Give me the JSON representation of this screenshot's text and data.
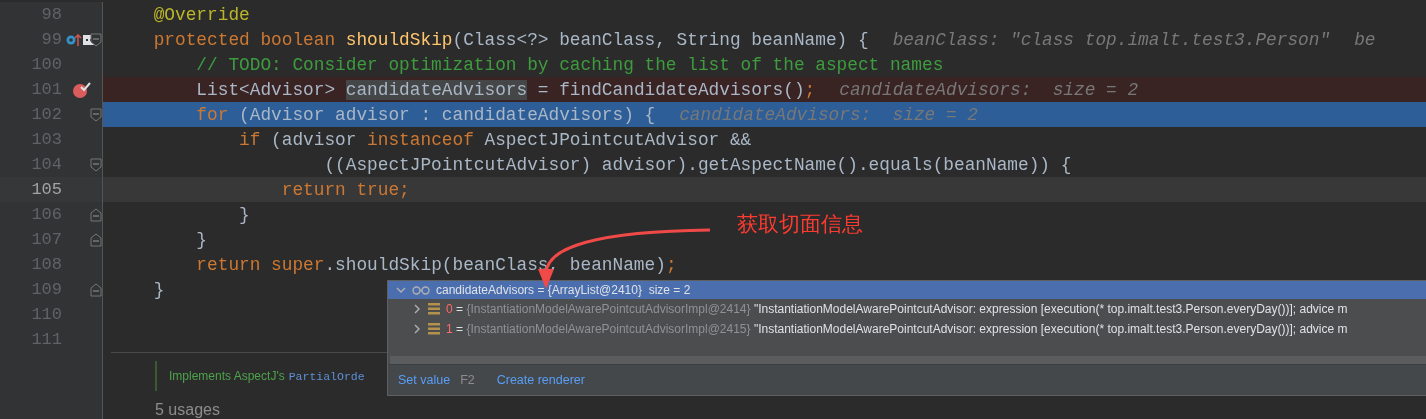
{
  "editor": {
    "lines": [
      {
        "number": "98",
        "breakpoint": false,
        "execution_point": false,
        "caret_line": false,
        "override_marker": false,
        "fold_start": false,
        "fold_end": false,
        "tokens": [
          {
            "text": "    @Override",
            "kind": "annotation"
          }
        ]
      },
      {
        "number": "99",
        "breakpoint": false,
        "execution_point": false,
        "caret_line": false,
        "override_marker": true,
        "fold_start": true,
        "fold_end": false,
        "tokens": [
          {
            "text": "    protected boolean ",
            "kind": "keyword"
          },
          {
            "text": "shouldSkip",
            "kind": "method"
          },
          {
            "text": "(Class<?> beanClass, String beanName) {",
            "kind": "plain"
          }
        ],
        "hints": [
          "beanClass: \"class top.imalt.test3.Person\"",
          "be"
        ]
      },
      {
        "number": "100",
        "breakpoint": false,
        "execution_point": false,
        "caret_line": false,
        "override_marker": false,
        "fold_start": false,
        "fold_end": false,
        "tokens": [
          {
            "text": "        // TODO: Consider optimization by caching the list of the aspect names",
            "kind": "comment"
          }
        ]
      },
      {
        "number": "101",
        "breakpoint": true,
        "execution_point": false,
        "caret_line": false,
        "override_marker": false,
        "fold_start": false,
        "fold_end": false,
        "tokens": [
          {
            "text": "        List<Advisor> ",
            "kind": "plain"
          },
          {
            "text": "candidateAdvisors",
            "kind": "usage"
          },
          {
            "text": " = findCandidateAdvisors()",
            "kind": "plain"
          },
          {
            "text": ";",
            "kind": "keyword"
          }
        ],
        "hints": [
          "candidateAdvisors:  size = 2"
        ]
      },
      {
        "number": "102",
        "breakpoint": false,
        "execution_point": true,
        "caret_line": false,
        "override_marker": false,
        "fold_start": true,
        "fold_end": false,
        "tokens": [
          {
            "text": "        for ",
            "kind": "keyword"
          },
          {
            "text": "(Advisor advisor : candidateAdvisors) {",
            "kind": "plain"
          }
        ],
        "hints": [
          "candidateAdvisors:  size = 2"
        ]
      },
      {
        "number": "103",
        "breakpoint": false,
        "execution_point": false,
        "caret_line": false,
        "override_marker": false,
        "fold_start": false,
        "fold_end": false,
        "tokens": [
          {
            "text": "            if ",
            "kind": "keyword"
          },
          {
            "text": "(advisor ",
            "kind": "plain"
          },
          {
            "text": "instanceof ",
            "kind": "keyword"
          },
          {
            "text": "AspectJPointcutAdvisor &&",
            "kind": "plain"
          }
        ]
      },
      {
        "number": "104",
        "breakpoint": false,
        "execution_point": false,
        "caret_line": false,
        "override_marker": false,
        "fold_start": true,
        "fold_end": false,
        "tokens": [
          {
            "text": "                    ((AspectJPointcutAdvisor) advisor).getAspectName().equals(beanName)) {",
            "kind": "plain"
          }
        ]
      },
      {
        "number": "105",
        "breakpoint": false,
        "execution_point": false,
        "caret_line": true,
        "override_marker": false,
        "fold_start": false,
        "fold_end": false,
        "tokens": [
          {
            "text": "                return true;",
            "kind": "keyword"
          }
        ]
      },
      {
        "number": "106",
        "breakpoint": false,
        "execution_point": false,
        "caret_line": false,
        "override_marker": false,
        "fold_start": false,
        "fold_end": true,
        "tokens": [
          {
            "text": "            }",
            "kind": "plain"
          }
        ]
      },
      {
        "number": "107",
        "breakpoint": false,
        "execution_point": false,
        "caret_line": false,
        "override_marker": false,
        "fold_start": false,
        "fold_end": true,
        "tokens": [
          {
            "text": "        }",
            "kind": "plain"
          }
        ]
      },
      {
        "number": "108",
        "breakpoint": false,
        "execution_point": false,
        "caret_line": false,
        "override_marker": false,
        "fold_start": false,
        "fold_end": false,
        "tokens": [
          {
            "text": "        return super",
            "kind": "keyword"
          },
          {
            "text": ".shouldSkip(beanClass, beanName)",
            "kind": "plain"
          },
          {
            "text": ";",
            "kind": "keyword"
          }
        ]
      },
      {
        "number": "109",
        "breakpoint": false,
        "execution_point": false,
        "caret_line": false,
        "override_marker": false,
        "fold_start": false,
        "fold_end": true,
        "tokens": [
          {
            "text": "    }",
            "kind": "plain"
          }
        ]
      },
      {
        "number": "110",
        "breakpoint": false,
        "execution_point": false,
        "caret_line": false,
        "override_marker": false,
        "fold_start": false,
        "fold_end": false
      },
      {
        "number": "111",
        "breakpoint": false,
        "execution_point": false,
        "caret_line": false,
        "override_marker": false,
        "fold_start": false,
        "fold_end": false
      }
    ],
    "doc": {
      "text": "Implements AspectJ's",
      "link": "PartialOrde"
    },
    "usages": "5 usages"
  },
  "popup": {
    "header": {
      "expanded": true,
      "name": "candidateAdvisors",
      "value": " = {ArrayList@2410}  size = 2"
    },
    "rows": [
      {
        "expanded": false,
        "index": "0",
        "separator": "=",
        "type": "{InstantiationModelAwarePointcutAdvisorImpl@2414}",
        "value": "\"InstantiationModelAwarePointcutAdvisor: expression [execution(* top.imalt.test3.Person.everyDay())]; advice m"
      },
      {
        "expanded": false,
        "index": "1",
        "separator": "=",
        "type": "{InstantiationModelAwarePointcutAdvisorImpl@2415}",
        "value": "\"InstantiationModelAwarePointcutAdvisor: expression [execution(* top.imalt.test3.Person.everyDay())]; advice m"
      }
    ],
    "actions": [
      {
        "label": "Set value",
        "shortcut": "F2"
      },
      {
        "label": "Create renderer"
      }
    ]
  },
  "annotation": {
    "text": "获取切面信息"
  }
}
